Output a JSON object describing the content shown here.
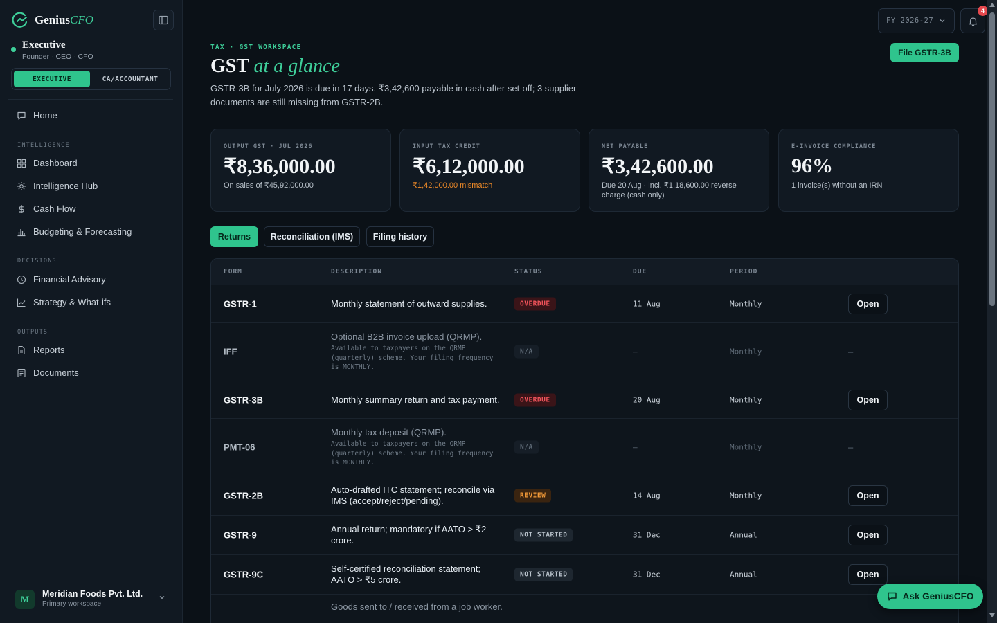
{
  "brand": {
    "name": "Genius",
    "name_accent": "CFO"
  },
  "role": {
    "title": "Executive",
    "subtitle": "Founder · CEO · CFO"
  },
  "mode_switch": {
    "options": [
      "EXECUTIVE",
      "CA/ACCOUNTANT"
    ],
    "active": "EXECUTIVE"
  },
  "nav": {
    "home": "Home",
    "sections": [
      {
        "label": "INTELLIGENCE",
        "items": [
          "Dashboard",
          "Intelligence Hub",
          "Cash Flow",
          "Budgeting & Forecasting"
        ]
      },
      {
        "label": "DECISIONS",
        "items": [
          "Financial Advisory",
          "Strategy & What-ifs"
        ]
      },
      {
        "label": "OUTPUTS",
        "items": [
          "Reports",
          "Documents"
        ]
      }
    ]
  },
  "workspace": {
    "initial": "M",
    "name": "Meridian Foods Pvt. Ltd.",
    "subtitle": "Primary workspace"
  },
  "topbar": {
    "fy": "FY 2026-27",
    "notification_count": "4"
  },
  "header": {
    "eyebrow": "TAX · GST WORKSPACE",
    "title": "GST",
    "title_accent": "at a glance",
    "description": "GSTR-3B for July 2026 is due in 17 days. ₹3,42,600 payable in cash after set-off; 3 supplier documents are still missing from GSTR-2B.",
    "primary_action": "File GSTR-3B"
  },
  "cards": [
    {
      "label": "OUTPUT GST · JUL 2026",
      "value": "₹8,36,000.00",
      "note": "On sales of ₹45,92,000.00",
      "tone": "normal"
    },
    {
      "label": "INPUT TAX CREDIT",
      "value": "₹6,12,000.00",
      "note": "₹1,42,000.00 mismatch",
      "tone": "warn"
    },
    {
      "label": "NET PAYABLE",
      "value": "₹3,42,600.00",
      "note": "Due 20 Aug · incl. ₹1,18,600.00 reverse charge (cash only)",
      "tone": "normal"
    },
    {
      "label": "E-INVOICE COMPLIANCE",
      "value": "96%",
      "note": "1 invoice(s) without an IRN",
      "tone": "normal"
    }
  ],
  "tabs": [
    {
      "label": "Returns",
      "active": true
    },
    {
      "label": "Reconciliation (IMS)",
      "active": false
    },
    {
      "label": "Filing history",
      "active": false
    }
  ],
  "table": {
    "columns": [
      "FORM",
      "DESCRIPTION",
      "STATUS",
      "DUE",
      "PERIOD"
    ],
    "rows": [
      {
        "form": "GSTR-1",
        "description": "Monthly statement of outward supplies.",
        "sub": "",
        "status": "OVERDUE",
        "status_kind": "overdue",
        "due": "11 Aug",
        "period": "Monthly",
        "action": "Open",
        "dim": false
      },
      {
        "form": "IFF",
        "description": "Optional B2B invoice upload (QRMP).",
        "sub": "Available to taxpayers on the QRMP (quarterly) scheme. Your filing frequency is MONTHLY.",
        "status": "N/A",
        "status_kind": "na",
        "due": "—",
        "period": "Monthly",
        "action": "–",
        "dim": true
      },
      {
        "form": "GSTR-3B",
        "description": "Monthly summary return and tax payment.",
        "sub": "",
        "status": "OVERDUE",
        "status_kind": "overdue",
        "due": "20 Aug",
        "period": "Monthly",
        "action": "Open",
        "dim": false
      },
      {
        "form": "PMT-06",
        "description": "Monthly tax deposit (QRMP).",
        "sub": "Available to taxpayers on the QRMP (quarterly) scheme. Your filing frequency is MONTHLY.",
        "status": "N/A",
        "status_kind": "na",
        "due": "—",
        "period": "Monthly",
        "action": "–",
        "dim": true
      },
      {
        "form": "GSTR-2B",
        "description": "Auto-drafted ITC statement; reconcile via IMS (accept/reject/pending).",
        "sub": "",
        "status": "REVIEW",
        "status_kind": "review",
        "due": "14 Aug",
        "period": "Monthly",
        "action": "Open",
        "dim": false
      },
      {
        "form": "GSTR-9",
        "description": "Annual return; mandatory if AATO > ₹2 crore.",
        "sub": "",
        "status": "NOT STARTED",
        "status_kind": "notstarted",
        "due": "31 Dec",
        "period": "Annual",
        "action": "Open",
        "dim": false
      },
      {
        "form": "GSTR-9C",
        "description": "Self-certified reconciliation statement; AATO > ₹5 crore.",
        "sub": "",
        "status": "NOT STARTED",
        "status_kind": "notstarted",
        "due": "31 Dec",
        "period": "Annual",
        "action": "Open",
        "dim": false
      },
      {
        "form": "",
        "description": "Goods sent to / received from a job worker.",
        "sub": "",
        "status": "",
        "status_kind": "",
        "due": "",
        "period": "",
        "action": "",
        "dim": true
      }
    ]
  },
  "assistant": {
    "label": "Ask GeniusCFO"
  },
  "colors": {
    "accent": "#2fc48d",
    "background": "#0b1117",
    "overdue": "#f2545b",
    "review": "#f29a38",
    "badge": "#e5484d"
  }
}
